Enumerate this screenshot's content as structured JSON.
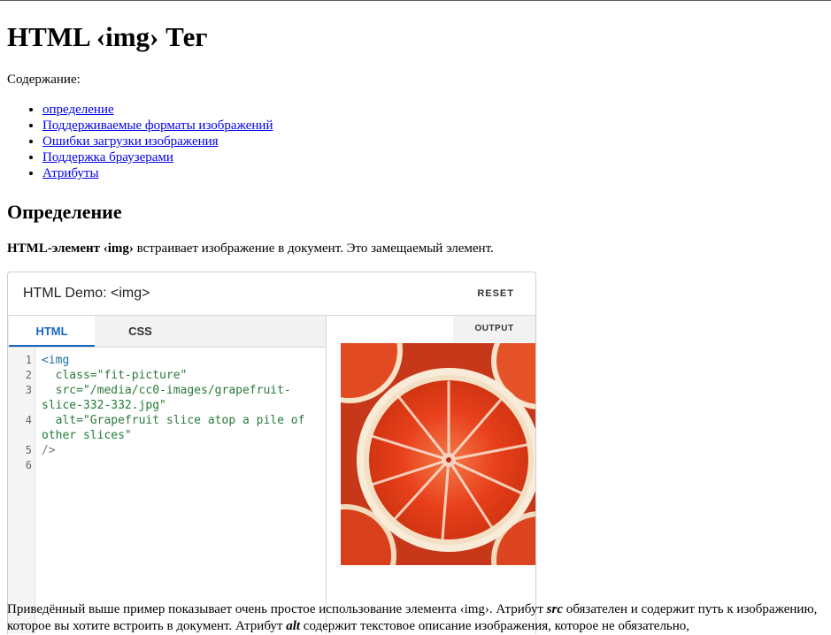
{
  "page": {
    "title": "HTML ‹img› Тег",
    "toc_label": "Содержание:",
    "toc": [
      "определение",
      "Поддерживаемые форматы изображений",
      "Ошибки загрузки изображения",
      "Поддержка браузерами",
      "Атрибуты"
    ],
    "section_heading": "Определение",
    "definition": {
      "strong": "HTML-элемент ‹img›",
      "rest": " встраивает изображение в документ. Это замещаемый элемент."
    }
  },
  "demo": {
    "title": "HTML Demo: <img>",
    "reset_label": "RESET",
    "tabs": [
      "HTML",
      "CSS"
    ],
    "active_tab": "HTML",
    "output_label": "OUTPUT",
    "line_numbers": [
      "1",
      "2",
      "3",
      "",
      "4",
      "",
      "5",
      "6"
    ],
    "code_lines": [
      "<img",
      "  class=\"fit-picture\"",
      "  src=\"/media/cc0-images/grapefruit-",
      "slice-332-332.jpg\"",
      "  alt=\"Grapefruit slice atop a pile of",
      "other slices\"",
      "/>",
      ""
    ],
    "image_alt": "Grapefruit slice atop a pile of other slices",
    "colors": {
      "accent": "#1565c0",
      "fruit_flesh": "#e8401c",
      "fruit_rind": "#f6e3c8"
    }
  },
  "paragraph": {
    "p1": "Приведённый выше пример показывает очень простое использование элемента ‹img›. Атрибут ",
    "b1": "src",
    "p2": " обязателен и содержит путь к изображению, которое вы хотите встроить в документ. Атрибут ",
    "b2": "alt",
    "p3": " содержит текстовое описание изображения, которое не обязательно,"
  }
}
